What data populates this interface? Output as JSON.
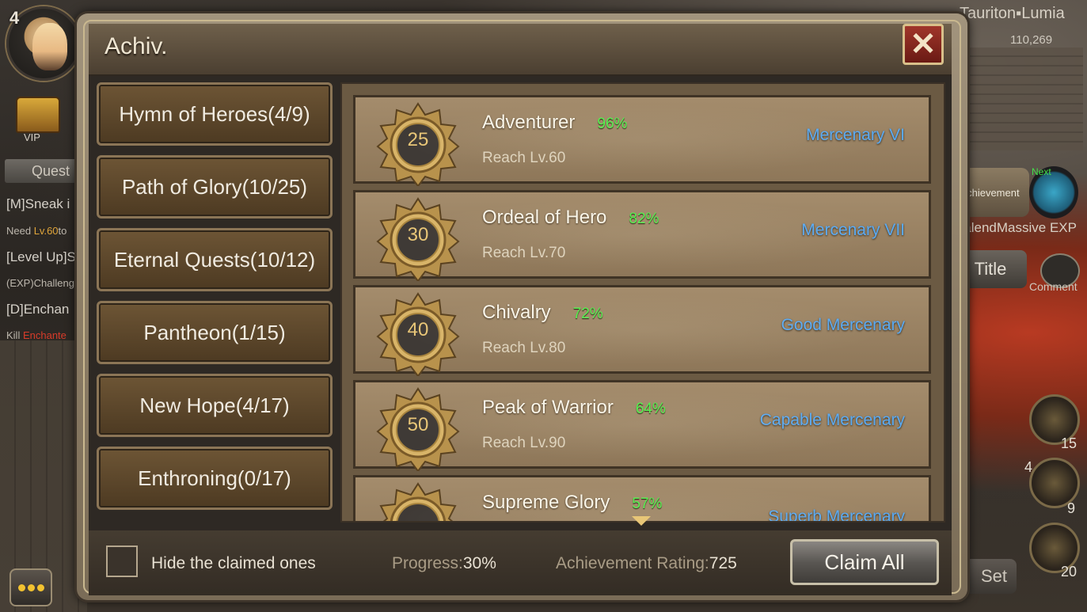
{
  "hud": {
    "player_level": "4",
    "vip_label": "VIP",
    "quest_tab": "Quest",
    "quest_lines": [
      {
        "text": "[M]Sneak i",
        "kind": "title"
      },
      {
        "prefix": "Need ",
        "highlight": "Lv.60",
        "suffix": "to",
        "kind": "small"
      },
      {
        "text": "[Level Up]S",
        "kind": "title"
      },
      {
        "text": "(EXP)Challeng",
        "kind": "small"
      },
      {
        "text": "[D]Enchan",
        "kind": "title"
      },
      {
        "prefix": "Kill ",
        "highlight": "Enchante",
        "suffix": "",
        "kind": "small-red"
      }
    ],
    "server": "Tauriton▪Lumia",
    "coords": "110,269",
    "achievement_side": "Achievement",
    "next_label": "Next",
    "calend_text": "CalendMassive EXP",
    "title_button": "Title",
    "comment_label": "Comment",
    "skill_counts": [
      "15",
      "4",
      "9",
      "20"
    ],
    "set_button": "Set"
  },
  "dialog": {
    "title": "Achiv.",
    "close_icon": "close-x",
    "close_symbol": "✕"
  },
  "categories": [
    {
      "label": "Hymn of Heroes(4/9)"
    },
    {
      "label": "Path of Glory(10/25)"
    },
    {
      "label": "Eternal Quests(10/12)"
    },
    {
      "label": "Pantheon(1/15)"
    },
    {
      "label": "New Hope(4/17)"
    },
    {
      "label": "Enthroning(0/17)"
    }
  ],
  "achievements": [
    {
      "level": "25",
      "name": "Adventurer",
      "percent": "96%",
      "requirement": "Reach Lv.60",
      "reward": "Mercenary VI"
    },
    {
      "level": "30",
      "name": "Ordeal of Hero",
      "percent": "82%",
      "requirement": "Reach Lv.70",
      "reward": "Mercenary VII"
    },
    {
      "level": "40",
      "name": "Chivalry",
      "percent": "72%",
      "requirement": "Reach Lv.80",
      "reward": "Good Mercenary"
    },
    {
      "level": "50",
      "name": "Peak of Warrior",
      "percent": "64%",
      "requirement": "Reach Lv.90",
      "reward": "Capable Mercenary"
    },
    {
      "level": "",
      "name": "Supreme Glory",
      "percent": "57%",
      "requirement": "",
      "reward": "Superb Mercenary"
    }
  ],
  "footer": {
    "hide_label": "Hide the claimed ones",
    "progress_label": "Progress:",
    "progress_value": "30%",
    "rating_label": "Achievement Rating:",
    "rating_value": "725",
    "claim_all": "Claim All"
  },
  "colors": {
    "percent_green": "#4ff04a",
    "reward_blue": "#5aaaf3",
    "close_red": "#a0362a",
    "gold": "#e8c677"
  }
}
